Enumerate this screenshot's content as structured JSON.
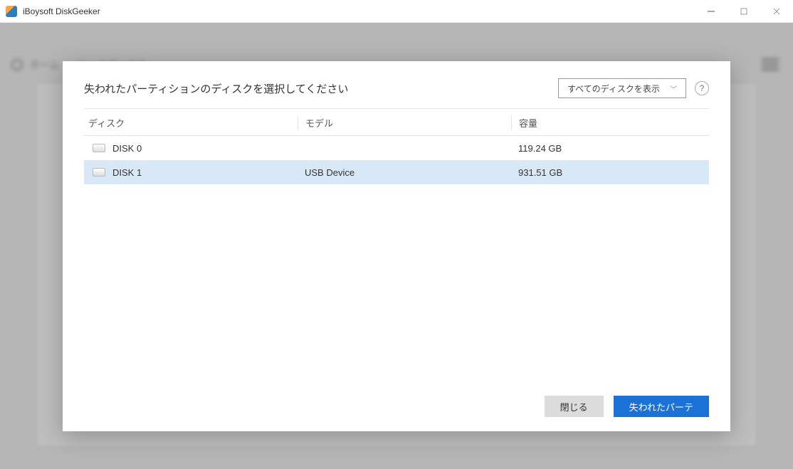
{
  "window": {
    "title": "iBoysoft DiskGeeker"
  },
  "breadcrumb": {
    "home": "ホーム",
    "section": "ツールボックス"
  },
  "modal": {
    "heading": "失われたパーティションのディスクを選択してください",
    "filter_label": "すべてのディスクを表示",
    "help_label": "?",
    "columns": {
      "disk": "ディスク",
      "model": "モデル",
      "capacity": "容量"
    },
    "rows": [
      {
        "name": "DISK 0",
        "model": "",
        "capacity": "119.24 GB",
        "selected": false
      },
      {
        "name": "DISK 1",
        "model": "USB Device",
        "capacity": "931.51 GB",
        "selected": true
      }
    ],
    "buttons": {
      "close": "閉じる",
      "recover": "失われたパーテ"
    }
  }
}
